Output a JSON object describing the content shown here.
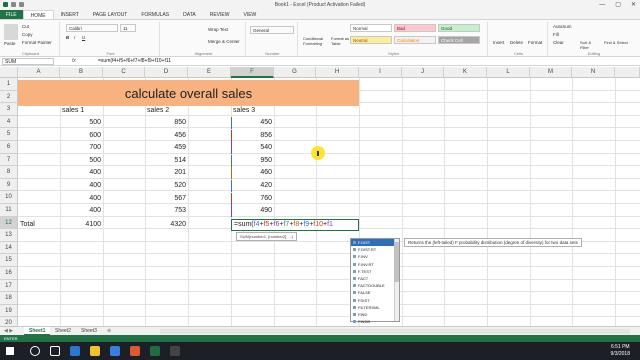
{
  "window": {
    "title": "Book1 - Excel (Product Activation Failed)",
    "controls": [
      "—",
      "▢",
      "✕"
    ]
  },
  "tabs": [
    "FILE",
    "HOME",
    "INSERT",
    "PAGE LAYOUT",
    "FORMULAS",
    "DATA",
    "REVIEW",
    "VIEW"
  ],
  "active_tab": "HOME",
  "ribbon": {
    "clipboard": {
      "cut": "Cut",
      "copy": "Copy",
      "format_painter": "Format Painter",
      "paste": "Paste",
      "label": "Clipboard"
    },
    "font": {
      "name": "Calibri",
      "size": "11",
      "label": "Font"
    },
    "alignment": {
      "wrap": "Wrap Text",
      "merge": "Merge & Center",
      "label": "Alignment"
    },
    "number": {
      "format": "General",
      "label": "Number"
    },
    "styles": {
      "conditional": "Conditional Formatting",
      "format_table": "Format as Table",
      "normal": "Normal",
      "bad": "Bad",
      "good": "Good",
      "neutral": "Neutral",
      "calculation": "Calculation",
      "check_cell": "Check Cell",
      "label": "Styles"
    },
    "cells": {
      "insert": "Insert",
      "delete": "Delete",
      "format": "Format",
      "label": "Cells"
    },
    "editing": {
      "autosum": "AutoSum",
      "fill": "Fill",
      "clear": "Clear",
      "sort": "Sort & Filter",
      "find": "Find & Select",
      "label": "Editing"
    }
  },
  "formula_bar": {
    "name_box": "SUM",
    "fx": "fx",
    "formula": "=sum(f4+f5+f6+f7+f8+f9+f10+f11"
  },
  "columns": [
    "A",
    "B",
    "C",
    "D",
    "E",
    "F",
    "G",
    "H",
    "I",
    "J",
    "K",
    "L",
    "M",
    "N"
  ],
  "active_column": "F",
  "rows": [
    "1",
    "2",
    "3",
    "4",
    "5",
    "6",
    "7",
    "8",
    "9",
    "10",
    "11",
    "12",
    "13",
    "14",
    "15",
    "16",
    "17",
    "18",
    "19",
    "20"
  ],
  "title": "calculate overall sales",
  "headers": {
    "sales1": "sales 1",
    "sales2": "sales 2",
    "sales3": "sales 3"
  },
  "sales1": [
    "500",
    "600",
    "700",
    "500",
    "400",
    "400",
    "400",
    "400"
  ],
  "sales2": [
    "850",
    "456",
    "459",
    "514",
    "201",
    "520",
    "567",
    "753"
  ],
  "sales3": [
    "450",
    "856",
    "540",
    "950",
    "460",
    "420",
    "760",
    "490"
  ],
  "total": {
    "label": "Total",
    "b": "4100",
    "d": "4320"
  },
  "active_cell": {
    "prefix": "=sum(",
    "tokens": [
      {
        "t": "f4",
        "c": "#3b6fd8"
      },
      {
        "t": "+",
        "c": "#222"
      },
      {
        "t": "f5",
        "c": "#c0392b"
      },
      {
        "t": "+",
        "c": "#222"
      },
      {
        "t": "f6",
        "c": "#7a3fb5"
      },
      {
        "t": "+",
        "c": "#222"
      },
      {
        "t": "f7",
        "c": "#2e8b57"
      },
      {
        "t": "+",
        "c": "#222"
      },
      {
        "t": "f8",
        "c": "#b5651d"
      },
      {
        "t": "+",
        "c": "#222"
      },
      {
        "t": "f9",
        "c": "#3b6fd8"
      },
      {
        "t": "+",
        "c": "#222"
      },
      {
        "t": "f10",
        "c": "#c0392b"
      },
      {
        "t": "+",
        "c": "#222"
      },
      {
        "t": "f1",
        "c": "#7a3fb5"
      }
    ]
  },
  "tooltip": "SUM(number1, [number2], ...)",
  "autocomplete": [
    "F.DIST",
    "F.DIST.RT",
    "F.INV",
    "F.INV.RT",
    "F.TEST",
    "FACT",
    "FACTDOUBLE",
    "FALSE",
    "FDIST",
    "FILTERXML",
    "FIND",
    "FINDB",
    "FINV"
  ],
  "autocomplete_selected": 0,
  "autocomplete_desc": "Returns the (left-tailed) F probability distribution (degree of diversity) for two data sets",
  "sheets": [
    "Sheet1",
    "Sheet2",
    "Sheet3"
  ],
  "active_sheet": "Sheet1",
  "status": "ENTER",
  "clock": {
    "time": "6:51 PM",
    "date": "9/3/2018"
  }
}
